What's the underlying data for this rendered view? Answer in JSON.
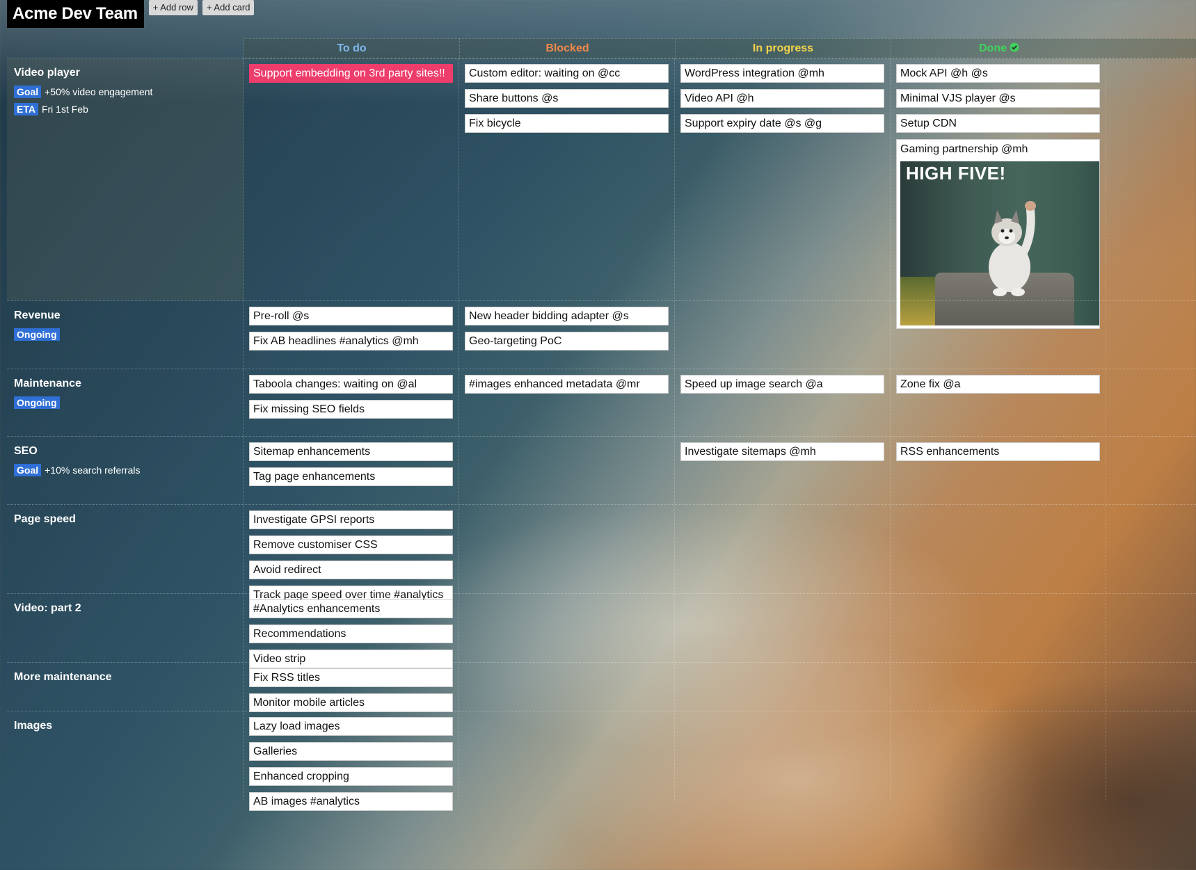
{
  "app": {
    "title": "Acme Dev Team",
    "add_row_label": "+ Add row",
    "add_card_label": "+ Add card"
  },
  "columns": [
    {
      "label": "To do",
      "color": "#7fb7ea"
    },
    {
      "label": "Blocked",
      "color": "#f08a4b"
    },
    {
      "label": "In progress",
      "color": "#f3d34a"
    },
    {
      "label": "Done",
      "color": "#3fd35c",
      "icon": "check-circle-icon"
    }
  ],
  "lanes": [
    {
      "title": "Video player",
      "meta": [
        {
          "tag": "Goal",
          "text": "+50% video engagement"
        },
        {
          "tag": "ETA",
          "text": "Fri 1st Feb"
        }
      ],
      "cells": [
        [
          {
            "text": "Support embedding on 3rd party sites!!",
            "urgent": true
          }
        ],
        [
          {
            "text": "Custom editor: waiting on @cc"
          },
          {
            "text": "Share buttons @s"
          },
          {
            "text": "Fix bicycle"
          }
        ],
        [
          {
            "text": "WordPress integration @mh"
          },
          {
            "text": "Video API @h"
          },
          {
            "text": "Support expiry date @s @g"
          }
        ],
        [
          {
            "text": "Mock API @h @s"
          },
          {
            "text": "Minimal VJS player @s"
          },
          {
            "text": "Setup CDN"
          },
          {
            "text": "Gaming partnership @mh",
            "image_text": "HIGH FIVE!"
          }
        ]
      ]
    },
    {
      "title": "Revenue",
      "meta": [
        {
          "tag": "Ongoing",
          "text": ""
        }
      ],
      "cells": [
        [
          {
            "text": "Pre-roll @s"
          },
          {
            "text": "Fix AB headlines #analytics @mh"
          }
        ],
        [
          {
            "text": "New header bidding adapter @s"
          },
          {
            "text": "Geo-targeting PoC"
          }
        ],
        [],
        []
      ]
    },
    {
      "title": "Maintenance",
      "meta": [
        {
          "tag": "Ongoing",
          "text": ""
        }
      ],
      "cells": [
        [
          {
            "text": "Taboola changes: waiting on @al"
          },
          {
            "text": "Fix missing SEO fields"
          }
        ],
        [
          {
            "text": "#images enhanced metadata @mr"
          }
        ],
        [
          {
            "text": "Speed up image search @a"
          }
        ],
        [
          {
            "text": "Zone fix @a"
          }
        ]
      ]
    },
    {
      "title": "SEO",
      "meta": [
        {
          "tag": "Goal",
          "text": "+10% search referrals"
        }
      ],
      "cells": [
        [
          {
            "text": "Sitemap enhancements"
          },
          {
            "text": "Tag page enhancements"
          }
        ],
        [],
        [
          {
            "text": "Investigate sitemaps @mh"
          }
        ],
        [
          {
            "text": "RSS enhancements"
          }
        ]
      ]
    },
    {
      "title": "Page speed",
      "meta": [],
      "cells": [
        [
          {
            "text": "Investigate GPSI reports"
          },
          {
            "text": "Remove customiser CSS"
          },
          {
            "text": "Avoid redirect"
          },
          {
            "text": "Track page speed over time #analytics"
          }
        ],
        [],
        [],
        []
      ]
    },
    {
      "title": "Video: part 2",
      "meta": [],
      "cells": [
        [
          {
            "text": "#Analytics enhancements"
          },
          {
            "text": "Recommendations"
          },
          {
            "text": "Video strip"
          }
        ],
        [],
        [],
        []
      ]
    },
    {
      "title": "More maintenance",
      "meta": [],
      "cells": [
        [
          {
            "text": "Fix RSS titles"
          },
          {
            "text": "Monitor mobile articles"
          }
        ],
        [],
        [],
        []
      ]
    },
    {
      "title": "Images",
      "meta": [],
      "cells": [
        [
          {
            "text": "Lazy load images"
          },
          {
            "text": "Galleries"
          },
          {
            "text": "Enhanced cropping"
          },
          {
            "text": "AB images #analytics"
          }
        ],
        [],
        [],
        []
      ]
    }
  ]
}
